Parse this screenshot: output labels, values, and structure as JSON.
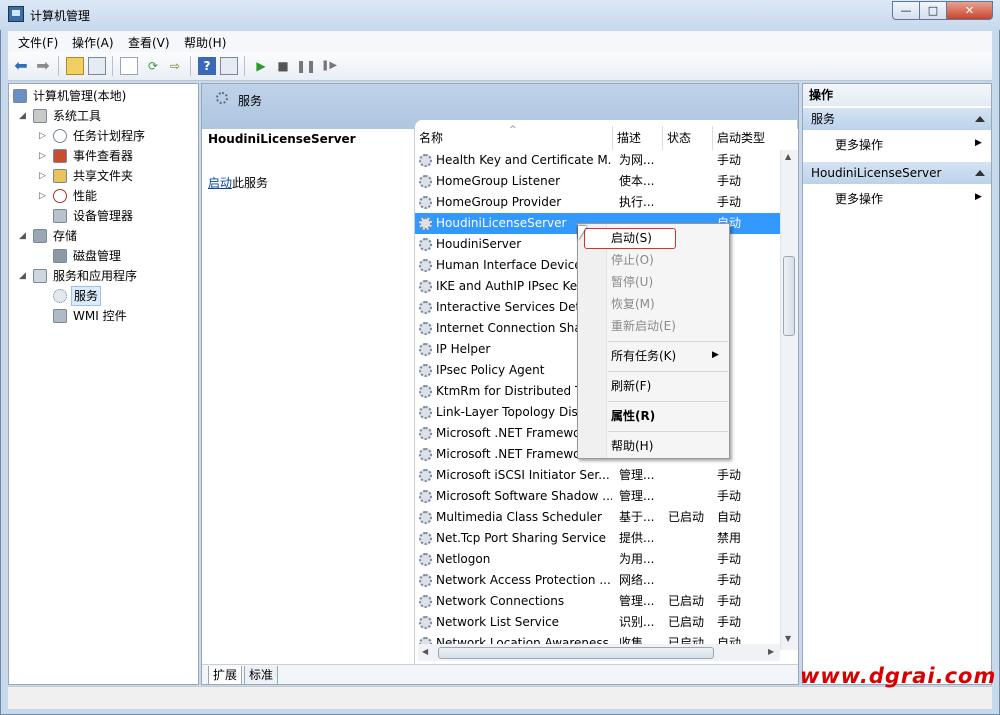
{
  "window": {
    "title": "计算机管理",
    "buttons": {
      "minimize": "—",
      "maximize": "□",
      "close": "✕"
    }
  },
  "menu": [
    "文件(F)",
    "操作(A)",
    "查看(V)",
    "帮助(H)"
  ],
  "toolbar": {
    "icons": [
      "back-icon",
      "forward-icon",
      "up-icon",
      "show-hide-tree-icon",
      "properties-icon",
      "refresh-icon",
      "export-icon",
      "help-icon",
      "show-hide-action-icon",
      "play-icon",
      "stop-icon",
      "pause-icon",
      "restart-icon"
    ]
  },
  "tree": {
    "root": "计算机管理(本地)",
    "items": [
      {
        "label": "系统工具",
        "level": 1,
        "expanded": true
      },
      {
        "label": "任务计划程序",
        "level": 2
      },
      {
        "label": "事件查看器",
        "level": 2
      },
      {
        "label": "共享文件夹",
        "level": 2
      },
      {
        "label": "性能",
        "level": 2
      },
      {
        "label": "设备管理器",
        "level": 2
      },
      {
        "label": "存储",
        "level": 1,
        "expanded": true
      },
      {
        "label": "磁盘管理",
        "level": 2
      },
      {
        "label": "服务和应用程序",
        "level": 1,
        "expanded": true
      },
      {
        "label": "服务",
        "level": 2,
        "selected": true
      },
      {
        "label": "WMI 控件",
        "level": 2
      }
    ]
  },
  "center": {
    "header": "服务",
    "selected_service": "HoudiniLicenseServer",
    "start_link": "启动",
    "start_suffix": "此服务",
    "columns": [
      "名称",
      "描述",
      "状态",
      "启动类型"
    ],
    "rows": [
      {
        "name": "Health Key and Certificate M...",
        "desc": "为网...",
        "status": "",
        "startup": "手动"
      },
      {
        "name": "HomeGroup Listener",
        "desc": "使本...",
        "status": "",
        "startup": "手动"
      },
      {
        "name": "HomeGroup Provider",
        "desc": "执行...",
        "status": "",
        "startup": "手动"
      },
      {
        "name": "HoudiniLicenseServer",
        "desc": "",
        "status": "",
        "startup": "自动",
        "selected": true
      },
      {
        "name": "HoudiniServer",
        "desc": "",
        "status": "",
        "startup": "动"
      },
      {
        "name": "Human Interface Device",
        "desc": "",
        "status": "",
        "startup": "动"
      },
      {
        "name": "IKE and AuthIP IPsec Ke",
        "desc": "",
        "status": "",
        "startup": "动"
      },
      {
        "name": "Interactive Services Dete",
        "desc": "",
        "status": "",
        "startup": "动"
      },
      {
        "name": "Internet Connection Sha",
        "desc": "",
        "status": "",
        "startup": "用"
      },
      {
        "name": "IP Helper",
        "desc": "",
        "status": "",
        "startup": "动"
      },
      {
        "name": "IPsec Policy Agent",
        "desc": "",
        "status": "",
        "startup": "动"
      },
      {
        "name": "KtmRm for Distributed T",
        "desc": "",
        "status": "",
        "startup": "动"
      },
      {
        "name": "Link-Layer Topology Dis",
        "desc": "",
        "status": "",
        "startup": "动"
      },
      {
        "name": "Microsoft .NET Framewo",
        "desc": "",
        "status": "",
        "startup": "动"
      },
      {
        "name": "Microsoft .NET Framewo",
        "desc": "",
        "status": "",
        "startup": "动"
      },
      {
        "name": "Microsoft iSCSI Initiator Ser...",
        "desc": "管理...",
        "status": "",
        "startup": "手动"
      },
      {
        "name": "Microsoft Software Shadow ...",
        "desc": "管理...",
        "status": "",
        "startup": "手动"
      },
      {
        "name": "Multimedia Class Scheduler",
        "desc": "基于...",
        "status": "已启动",
        "startup": "自动"
      },
      {
        "name": "Net.Tcp Port Sharing Service",
        "desc": "提供...",
        "status": "",
        "startup": "禁用"
      },
      {
        "name": "Netlogon",
        "desc": "为用...",
        "status": "",
        "startup": "手动"
      },
      {
        "name": "Network Access Protection ...",
        "desc": "网络...",
        "status": "",
        "startup": "手动"
      },
      {
        "name": "Network Connections",
        "desc": "管理...",
        "status": "已启动",
        "startup": "手动"
      },
      {
        "name": "Network List Service",
        "desc": "识别...",
        "status": "已启动",
        "startup": "手动"
      },
      {
        "name": "Network Location Awareness",
        "desc": "收集...",
        "status": "已启动",
        "startup": "自动"
      }
    ],
    "tabs": [
      "扩展",
      "标准"
    ]
  },
  "actions": {
    "title": "操作",
    "sections": [
      {
        "header": "服务",
        "item": "更多操作"
      },
      {
        "header": "HoudiniLicenseServer",
        "item": "更多操作"
      }
    ]
  },
  "context_menu": {
    "items": [
      {
        "label": "启动(S)",
        "disabled": false
      },
      {
        "label": "停止(O)",
        "disabled": true
      },
      {
        "label": "暂停(U)",
        "disabled": true
      },
      {
        "label": "恢复(M)",
        "disabled": true
      },
      {
        "label": "重新启动(E)",
        "disabled": true
      },
      {
        "label": "所有任务(K)",
        "disabled": false,
        "submenu": true
      },
      {
        "label": "刷新(F)",
        "disabled": false
      },
      {
        "label": "属性(R)",
        "disabled": false,
        "bold": true
      },
      {
        "label": "帮助(H)",
        "disabled": false
      }
    ]
  },
  "watermark": "www.dgrai.com"
}
